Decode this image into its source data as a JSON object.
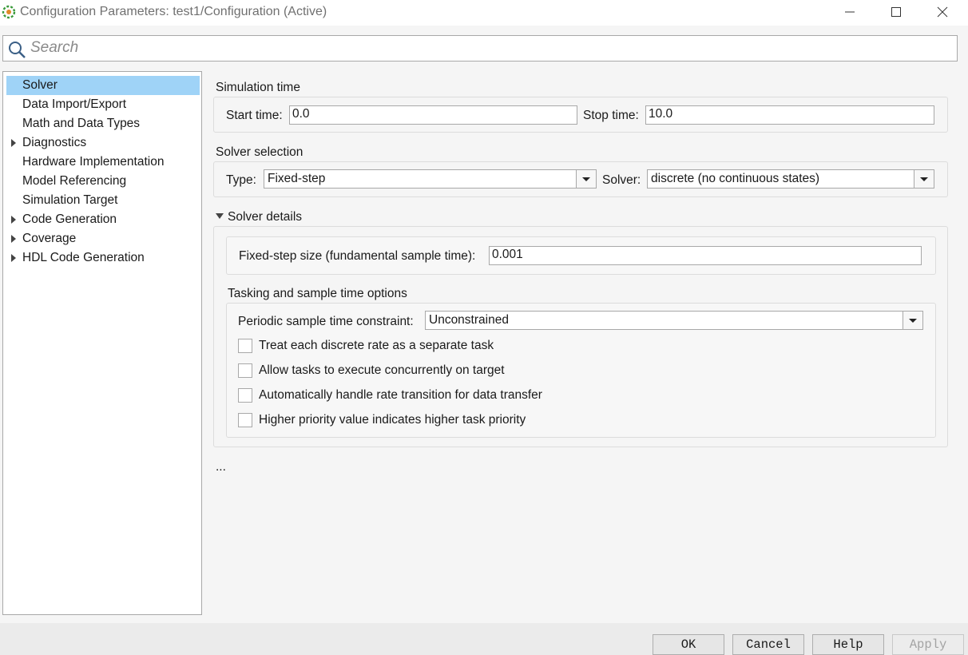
{
  "window": {
    "title": "Configuration Parameters: test1/Configuration (Active)",
    "controls": [
      "minimize-icon",
      "maximize-icon",
      "close-icon"
    ]
  },
  "search": {
    "placeholder": "Search",
    "value": ""
  },
  "tree": {
    "items": [
      {
        "label": "Solver",
        "expandable": false,
        "selected": true
      },
      {
        "label": "Data Import/Export",
        "expandable": false
      },
      {
        "label": "Math and Data Types",
        "expandable": false
      },
      {
        "label": "Diagnostics",
        "expandable": true
      },
      {
        "label": "Hardware Implementation",
        "expandable": false
      },
      {
        "label": "Model Referencing",
        "expandable": false
      },
      {
        "label": "Simulation Target",
        "expandable": false
      },
      {
        "label": "Code Generation",
        "expandable": true
      },
      {
        "label": "Coverage",
        "expandable": true
      },
      {
        "label": "HDL Code Generation",
        "expandable": true
      }
    ]
  },
  "simulation_time": {
    "title": "Simulation time",
    "start_label": "Start time:",
    "start_value": "0.0",
    "stop_label": "Stop time:",
    "stop_value": "10.0"
  },
  "solver_selection": {
    "title": "Solver selection",
    "type_label": "Type:",
    "type_value": "Fixed-step",
    "solver_label": "Solver:",
    "solver_value": "discrete (no continuous states)"
  },
  "solver_details": {
    "title": "Solver details",
    "expanded": true,
    "fixed_step_label": "Fixed-step size (fundamental sample time):",
    "fixed_step_value": "0.001",
    "tasking": {
      "title": "Tasking and sample time options",
      "periodic_label": "Periodic sample time constraint:",
      "periodic_value": "Unconstrained",
      "checkboxes": [
        {
          "label": "Treat each discrete rate as a separate task",
          "checked": false
        },
        {
          "label": "Allow tasks to execute concurrently on target",
          "checked": false
        },
        {
          "label": "Automatically handle rate transition for data transfer",
          "checked": false
        },
        {
          "label": "Higher priority value indicates higher task priority",
          "checked": false
        }
      ]
    }
  },
  "more": "...",
  "buttons": {
    "ok": "OK",
    "cancel": "Cancel",
    "help": "Help",
    "apply": "Apply"
  },
  "colors": {
    "selection": "#9fd3f7",
    "background": "#f5f5f5",
    "disabled_text": "#a3a3a3"
  }
}
